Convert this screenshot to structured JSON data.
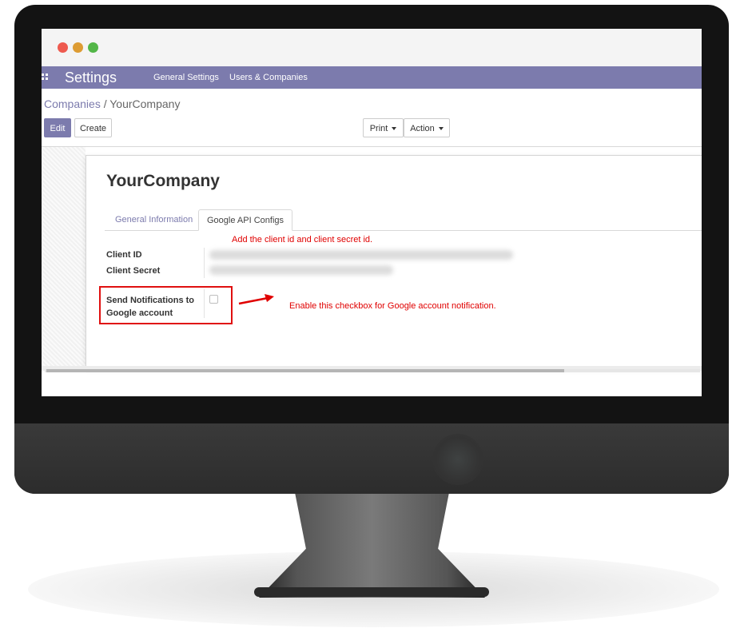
{
  "window": {
    "controls": [
      "close",
      "minimize",
      "maximize"
    ]
  },
  "navbar": {
    "apps_icon": "apps-grid-icon",
    "title": "Settings",
    "items": [
      {
        "label": "General Settings"
      },
      {
        "label": "Users & Companies"
      }
    ],
    "color": "#7c7bad"
  },
  "breadcrumb": {
    "parent": "Companies",
    "separator": "/",
    "current": "YourCompany"
  },
  "toolbar": {
    "edit_label": "Edit",
    "create_label": "Create",
    "print_label": "Print",
    "action_label": "Action"
  },
  "form": {
    "company_name": "YourCompany",
    "tabs": [
      {
        "label": "General Information",
        "active": false
      },
      {
        "label": "Google API Configs",
        "active": true
      }
    ],
    "fields": {
      "client_id_label": "Client ID",
      "client_secret_label": "Client Secret",
      "notifications_label": "Send Notifications to Google account",
      "notifications_checked": false
    }
  },
  "annotations": {
    "client_note": "Add the client id and client secret id.",
    "checkbox_note": "Enable this checkbox for Google account notification.",
    "color": "#e00000"
  }
}
